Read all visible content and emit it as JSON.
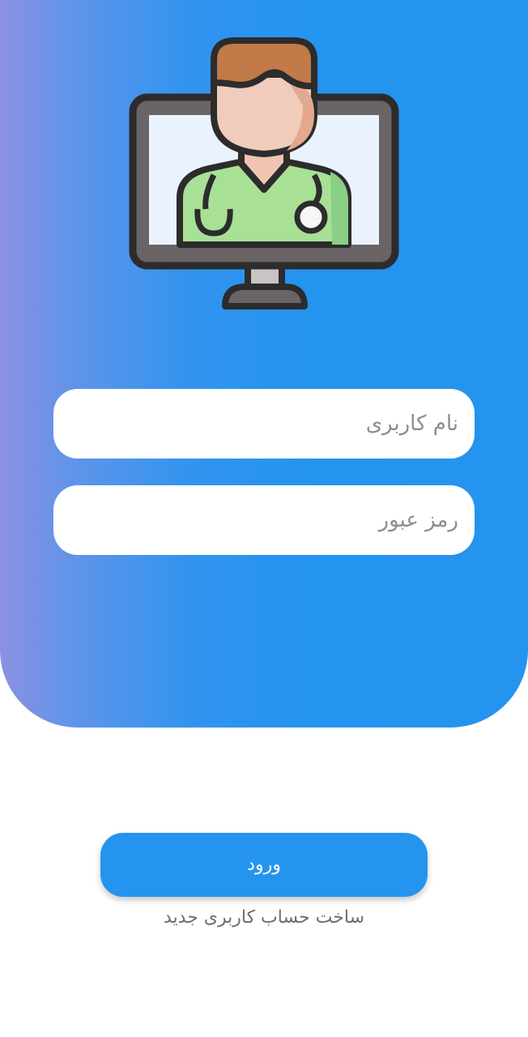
{
  "login_form": {
    "username_placeholder": "نام کاربری",
    "password_placeholder": "رمز عبور"
  },
  "actions": {
    "login_label": "ورود",
    "signup_label": "ساخت حساب کاربری جدید"
  },
  "illustration": {
    "icon": "doctor-monitor-icon"
  },
  "colors": {
    "gradient_start": "#8c91e0",
    "gradient_end": "#2494ef",
    "button": "#2594ef",
    "input_background": "#ffffff",
    "placeholder": "#8e8e8e",
    "link_text": "#6e6e6e"
  }
}
